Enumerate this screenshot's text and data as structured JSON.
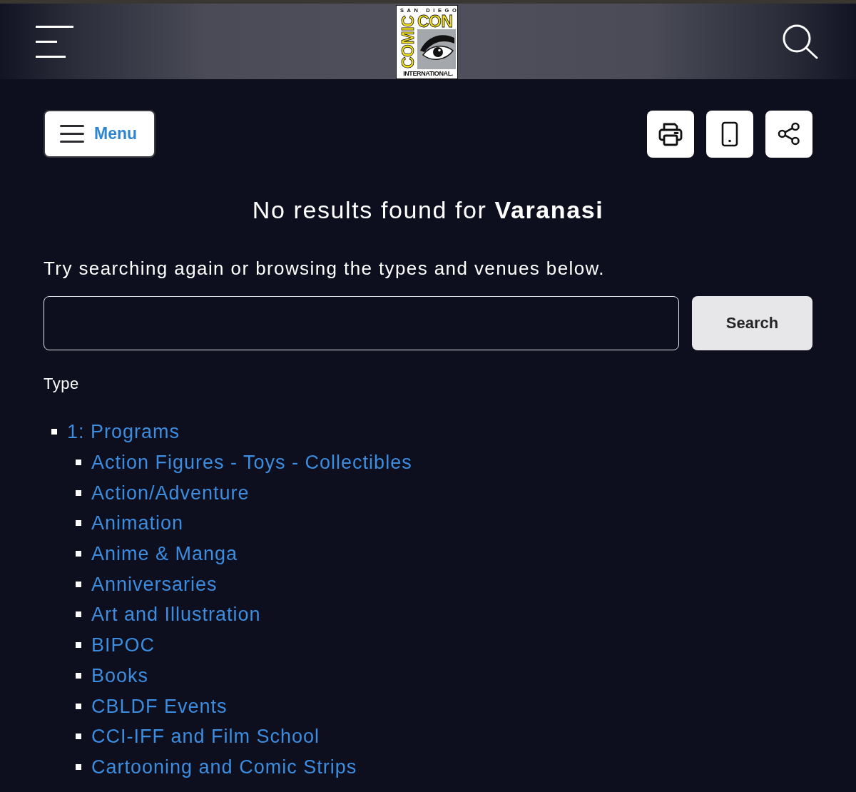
{
  "header": {
    "logo": {
      "top_text": "SAN DIEGO",
      "side_text": "COMIC",
      "right_text": "CON",
      "bottom_text": "INTERNATIONAL."
    }
  },
  "toolbar": {
    "menu_button": {
      "label": "Menu"
    },
    "icon_buttons": [
      {
        "kind": "print"
      },
      {
        "kind": "mobile"
      },
      {
        "kind": "share"
      }
    ]
  },
  "results": {
    "heading": "No results found for **Varanasi**",
    "hint": "Try searching again or browsing the types and venues below.",
    "search_button": "Search"
  },
  "type_section": {
    "label": "Type",
    "items": [
      {
        "label": "1: Programs",
        "children": [
          {
            "label": "Action Figures - Toys - Collectibles"
          },
          {
            "label": "Action/Adventure"
          },
          {
            "label": "Animation"
          },
          {
            "label": "Anime & Manga"
          },
          {
            "label": "Anniversaries"
          },
          {
            "label": "Art and Illustration"
          },
          {
            "label": "BIPOC"
          },
          {
            "label": "Books"
          },
          {
            "label": "CBLDF Events"
          },
          {
            "label": "CCI-IFF and Film School"
          },
          {
            "label": "Cartooning and Comic Strips"
          }
        ]
      }
    ]
  }
}
